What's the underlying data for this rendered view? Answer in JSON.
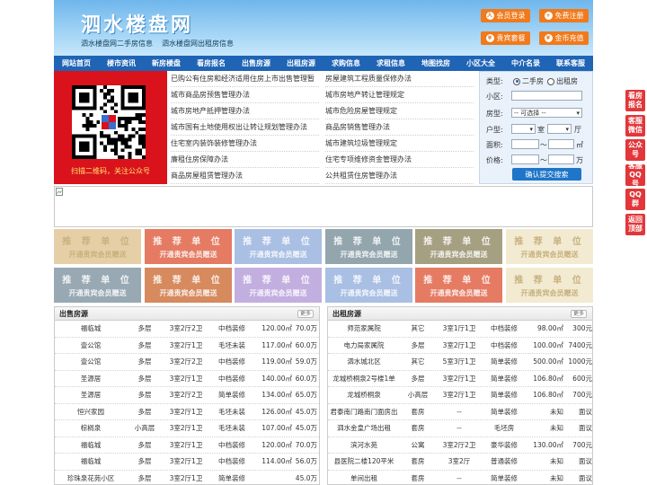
{
  "site": {
    "logo": "泗水楼盘网",
    "slogan": [
      "泗水楼盘网二手房信息",
      "泗水楼盘网出租房信息"
    ]
  },
  "header_buttons": [
    "会员登录",
    "免费注册",
    "贵宾套餐",
    "金币充值"
  ],
  "nav": [
    "网站首页",
    "楼市资讯",
    "新房楼盘",
    "看房报名",
    "出售房源",
    "出租房源",
    "求购信息",
    "求租信息",
    "地图找房",
    "小区大全",
    "中介名录",
    "联系客服"
  ],
  "qr_caption": "扫描二维码，关注公众号",
  "links_left": [
    "已购公有住房和经济适用住房上市出售管理暂",
    "城市商品房预售管理办法",
    "城市房地产抵押管理办法",
    "城市国有土地使用权出让转让规划管理办法",
    "住宅室内装饰装修管理办法",
    "廉租住房保障办法",
    "商品房屋租赁管理办法"
  ],
  "links_right": [
    "房屋建筑工程质量保修办法",
    "城市房地产转让管理规定",
    "城市危险房屋管理规定",
    "商品房销售管理办法",
    "城市建筑垃圾管理规定",
    "住宅专项维修资金管理办法",
    "公共租赁住房管理办法"
  ],
  "search": {
    "type_label": "类型:",
    "radio_options": [
      "二手房",
      "出租房"
    ],
    "community_label": "小区:",
    "housetype_label": "房型:",
    "housetype_value": "-- 可选择 --",
    "layout_label": "户型:",
    "layout_room": "室",
    "layout_hall": "厅",
    "area_label": "面积:",
    "area_unit": "㎡",
    "price_label": "价格:",
    "price_unit": "万",
    "tilde": "～",
    "submit": "确认提交搜索"
  },
  "recommend": {
    "title": "推 荐 单 位",
    "sub": "开通贵宾会员赠送"
  },
  "colors": {
    "tiles": [
      "#e6cfa6",
      "#e57b63",
      "#a9bfe3",
      "#93a6ae",
      "#a6a082",
      "#f3ead2",
      "#98a9b4",
      "#d68a5e",
      "#c3aee0",
      "#a9bfe3",
      "#e57b63",
      "#f3ead2",
      "#93a6ae",
      "#9fb1bb"
    ],
    "accent": "#1f64b5",
    "orange": "#f07a1c"
  },
  "panel_sale": {
    "title": "出售房源",
    "more": "更多",
    "rows": [
      [
        "福临城",
        "多层",
        "3室2厅2卫",
        "中档装修",
        "120.00㎡",
        "70.0万"
      ],
      [
        "壹公馆",
        "多层",
        "3室2厅1卫",
        "毛坯未装",
        "117.00㎡",
        "60.0万"
      ],
      [
        "壹公馆",
        "多层",
        "3室2厅2卫",
        "中档装修",
        "119.00㎡",
        "59.0万"
      ],
      [
        "圣源居",
        "多层",
        "3室2厅1卫",
        "中档装修",
        "140.00㎡",
        "60.0万"
      ],
      [
        "圣源居",
        "多层",
        "3室2厅2卫",
        "简单装修",
        "134.00㎡",
        "65.0万"
      ],
      [
        "恒兴家园",
        "多层",
        "3室2厅1卫",
        "毛坯未装",
        "126.00㎡",
        "45.0万"
      ],
      [
        "棕榈泉",
        "小高层",
        "3室2厅1卫",
        "毛坯未装",
        "107.00㎡",
        "45.0万"
      ],
      [
        "福临城",
        "多层",
        "3室2厅1卫",
        "中档装修",
        "120.00㎡",
        "70.0万"
      ],
      [
        "福临城",
        "多层",
        "3室2厅1卫",
        "中档装修",
        "114.00㎡",
        "56.0万"
      ],
      [
        "珍珠泉花苑小区",
        "多层",
        "3室2厅1卫",
        "简单装修",
        "",
        "45.0万"
      ]
    ]
  },
  "panel_rent": {
    "title": "出租房源",
    "more": "更多",
    "rows": [
      [
        "师范家属院",
        "其它",
        "3室1厅1卫",
        "中档装修",
        "98.00㎡",
        "300元"
      ],
      [
        "电力局家属院",
        "多层",
        "3室2厅1卫",
        "中档装修",
        "100.00㎡",
        "7400元"
      ],
      [
        "泗水城北区",
        "其它",
        "5室3厅1卫",
        "简单装修",
        "500.00㎡",
        "1000元"
      ],
      [
        "龙城桥桐泉2号楼1单",
        "多层",
        "3室2厅1卫",
        "简单装修",
        "106.80㎡",
        "600元"
      ],
      [
        "龙城桥桐泉",
        "小高层",
        "3室2厅1卫",
        "简单装修",
        "106.80㎡",
        "700元"
      ],
      [
        "君泰南门路南门面房出",
        "套房",
        "--",
        "简单装修",
        "未知",
        "面议"
      ],
      [
        "泗水金皇广场出租",
        "套房",
        "--",
        "毛坯房",
        "未知",
        "面议"
      ],
      [
        "滨河水苑",
        "公寓",
        "3室2厅2卫",
        "豪华装修",
        "130.00㎡",
        "700元"
      ],
      [
        "县医院二楼120平米",
        "套房",
        "3室2厅",
        "普通装修",
        "未知",
        "面议"
      ],
      [
        "单间出租",
        "套房",
        "--",
        "简单装修",
        "未知",
        "面议"
      ]
    ]
  },
  "side_float": [
    "看房报名",
    "客服微信",
    "公众号",
    "客服QQ号",
    "QQ群",
    "返回顶部"
  ]
}
